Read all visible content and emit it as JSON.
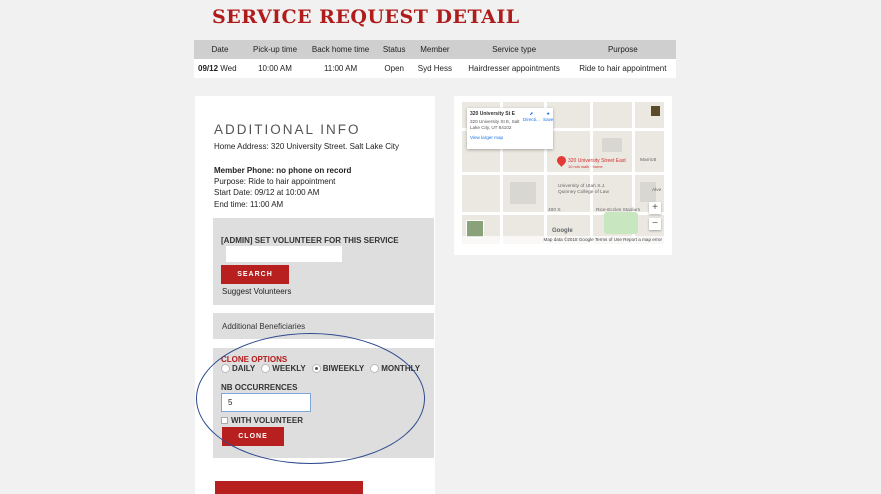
{
  "page_title": "SERVICE REQUEST DETAIL",
  "table": {
    "headers": [
      "Date",
      "Pick-up time",
      "Back home time",
      "Status",
      "Member",
      "Service type",
      "Purpose"
    ],
    "row": {
      "date_bold": "09/12",
      "date_rest": " Wed",
      "pickup": "10:00 AM",
      "back_home": "11:00 AM",
      "status": "Open",
      "member": "Syd Hess",
      "service_type": "Hairdresser appointments",
      "purpose": "Ride to hair appointment"
    }
  },
  "additional_info": {
    "title": "ADDITIONAL INFO",
    "home_address": "Home Address: 320 University Street. Salt Lake City",
    "member_phone": "Member Phone: no phone on record",
    "purpose": "Purpose: Ride to hair appointment",
    "start_date": "Start Date: 09/12 at 10:00 AM",
    "end_time": "End time: 11:00 AM"
  },
  "admin": {
    "label": "[ADMIN] SET VOLUNTEER FOR THIS SERVICE",
    "input_value": "",
    "search_label": "SEARCH",
    "suggest_label": "Suggest Volunteers"
  },
  "beneficiaries": {
    "label": "Additional Beneficiaries"
  },
  "clone": {
    "title": "CLONE OPTIONS",
    "options": [
      {
        "label": "DAILY",
        "checked": false
      },
      {
        "label": "WEEKLY",
        "checked": false
      },
      {
        "label": "BIWEEKLY",
        "checked": true
      },
      {
        "label": "MONTHLY",
        "checked": false
      }
    ],
    "nb_label": "NB OCCURRENCES",
    "nb_value": "5",
    "with_volunteer_label": "WITH VOLUNTEER",
    "clone_label": "CLONE"
  },
  "map": {
    "popup_title": "320 University St E",
    "popup_address": "320 University St E, Salt Lake City, UT 84102",
    "popup_link": "View larger map",
    "popup_directions": "Directi...",
    "popup_save": "Save",
    "pin_label": "320 University Street East",
    "pin_sublabel": "10 min walk · home",
    "place_label_1": "University of Utah S.J.",
    "place_label_2": "Quinney College of Law",
    "place_label_3": "Rice-Eccles Stadium",
    "street_label": "400 S",
    "marriott": "Marriott",
    "alve": "Alve",
    "google_label": "Google",
    "footer": "Map data ©2018 Google   Terms of Use   Report a map error",
    "zoom_in": "+",
    "zoom_out": "−"
  },
  "colors": {
    "accent": "#b81f1f",
    "title": "#b01c1c",
    "background": "#f1f1f1"
  }
}
